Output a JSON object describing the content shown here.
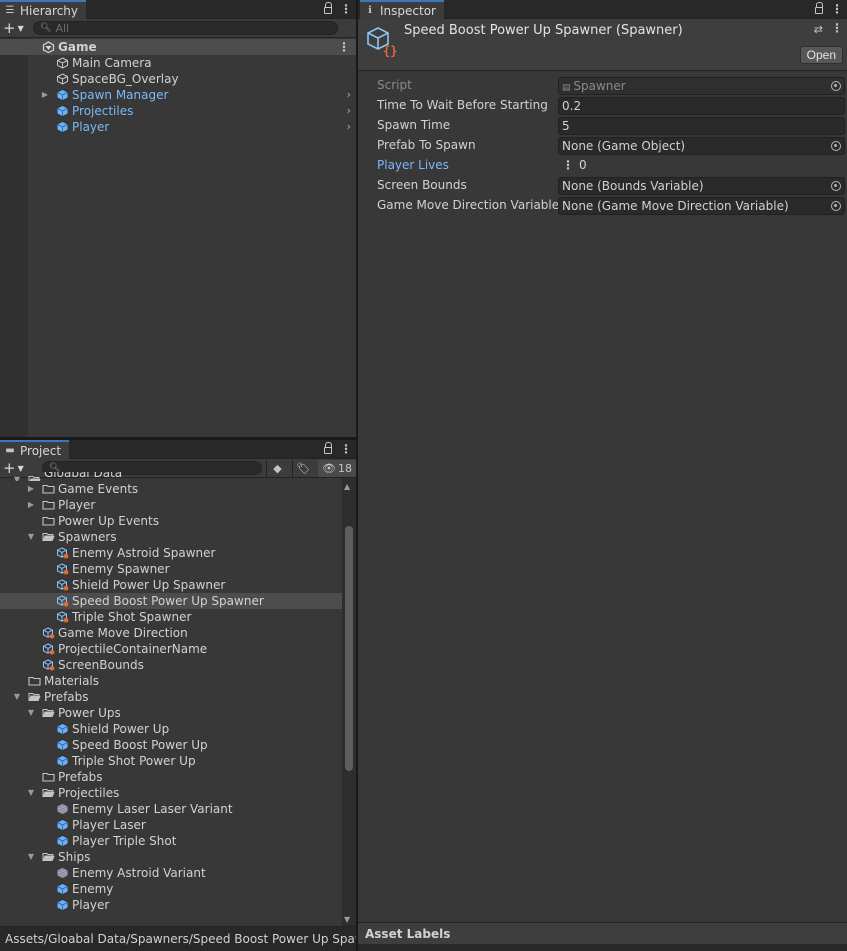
{
  "hierarchy": {
    "tab_label": "Hierarchy",
    "search_placeholder": "All",
    "items": [
      {
        "label": "Game",
        "depth": 0,
        "icon": "scene-icon",
        "expanded": true,
        "bold": true,
        "selected": true
      },
      {
        "label": "Main Camera",
        "depth": 1,
        "icon": "gameobject-icon"
      },
      {
        "label": "SpaceBG_Overlay",
        "depth": 1,
        "icon": "gameobject-icon"
      },
      {
        "label": "Spawn Manager",
        "depth": 1,
        "icon": "prefab-icon",
        "blue": true,
        "foldout": "collapsed",
        "chevron": true
      },
      {
        "label": "Projectiles",
        "depth": 1,
        "icon": "prefab-icon",
        "blue": true,
        "chevron": true
      },
      {
        "label": "Player",
        "depth": 1,
        "icon": "prefab-icon",
        "blue": true,
        "chevron": true
      }
    ]
  },
  "project": {
    "tab_label": "Project",
    "hidden_count": "18",
    "items": [
      {
        "label": "Gloabal Data",
        "depth": 1,
        "icon": "folder-open-icon",
        "foldout": "expanded",
        "partial": true
      },
      {
        "label": "Game Events",
        "depth": 2,
        "icon": "folder-icon",
        "foldout": "collapsed"
      },
      {
        "label": "Player",
        "depth": 2,
        "icon": "folder-icon",
        "foldout": "collapsed"
      },
      {
        "label": "Power Up Events",
        "depth": 2,
        "icon": "folder-icon"
      },
      {
        "label": "Spawners",
        "depth": 2,
        "icon": "folder-open-icon",
        "foldout": "expanded"
      },
      {
        "label": "Enemy Astroid Spawner",
        "depth": 3,
        "icon": "scriptable-icon"
      },
      {
        "label": "Enemy Spawner",
        "depth": 3,
        "icon": "scriptable-icon"
      },
      {
        "label": "Shield Power Up Spawner",
        "depth": 3,
        "icon": "scriptable-icon"
      },
      {
        "label": "Speed Boost Power Up Spawner",
        "depth": 3,
        "icon": "scriptable-icon",
        "selected": true
      },
      {
        "label": "Triple Shot Spawner",
        "depth": 3,
        "icon": "scriptable-icon"
      },
      {
        "label": "Game Move Direction",
        "depth": 2,
        "icon": "scriptable-icon"
      },
      {
        "label": "ProjectileContainerName",
        "depth": 2,
        "icon": "scriptable-icon"
      },
      {
        "label": "ScreenBounds",
        "depth": 2,
        "icon": "scriptable-icon"
      },
      {
        "label": "Materials",
        "depth": 1,
        "icon": "folder-icon"
      },
      {
        "label": "Prefabs",
        "depth": 1,
        "icon": "folder-open-icon",
        "foldout": "expanded"
      },
      {
        "label": "Power Ups",
        "depth": 2,
        "icon": "folder-open-icon",
        "foldout": "expanded"
      },
      {
        "label": "Shield Power Up",
        "depth": 3,
        "icon": "prefab-icon"
      },
      {
        "label": "Speed Boost Power Up",
        "depth": 3,
        "icon": "prefab-icon"
      },
      {
        "label": "Triple Shot Power Up",
        "depth": 3,
        "icon": "prefab-icon"
      },
      {
        "label": "Prefabs",
        "depth": 2,
        "icon": "folder-icon"
      },
      {
        "label": "Projectiles",
        "depth": 2,
        "icon": "folder-open-icon",
        "foldout": "expanded"
      },
      {
        "label": "Enemy Laser Laser Variant",
        "depth": 3,
        "icon": "prefab-variant-icon"
      },
      {
        "label": "Player Laser",
        "depth": 3,
        "icon": "prefab-icon"
      },
      {
        "label": "Player Triple Shot",
        "depth": 3,
        "icon": "prefab-icon"
      },
      {
        "label": "Ships",
        "depth": 2,
        "icon": "folder-open-icon",
        "foldout": "expanded"
      },
      {
        "label": "Enemy Astroid Variant",
        "depth": 3,
        "icon": "prefab-variant-icon"
      },
      {
        "label": "Enemy",
        "depth": 3,
        "icon": "prefab-icon"
      },
      {
        "label": "Player",
        "depth": 3,
        "icon": "prefab-icon"
      }
    ]
  },
  "status_path": "Assets/Gloabal Data/Spawners/Speed Boost Power Up Spawner.asset",
  "inspector": {
    "tab_label": "Inspector",
    "title": "Speed Boost Power Up Spawner (Spawner)",
    "open_label": "Open",
    "properties": [
      {
        "label": "Script",
        "value": "Spawner",
        "disabled": true,
        "script": true
      },
      {
        "label": "Time To Wait Before Starting",
        "value": "0.2"
      },
      {
        "label": "Spawn Time",
        "value": "5"
      },
      {
        "label": "Prefab To Spawn",
        "value": "None (Game Object)",
        "picker": true
      },
      {
        "label": "Player Lives",
        "value": "0",
        "blue": true,
        "handle": true
      },
      {
        "label": "Screen Bounds",
        "value": "None (Bounds Variable)",
        "picker": true
      },
      {
        "label": "Game Move Direction Variable",
        "value": "None (Game Move Direction Variable)",
        "picker": true
      }
    ],
    "asset_labels": "Asset Labels"
  },
  "colors": {
    "accent_blue": "#3a79bb",
    "prefab_blue": "#7cb8f8",
    "selected_row": "#4d4d4d",
    "panel_bg": "#383838"
  }
}
